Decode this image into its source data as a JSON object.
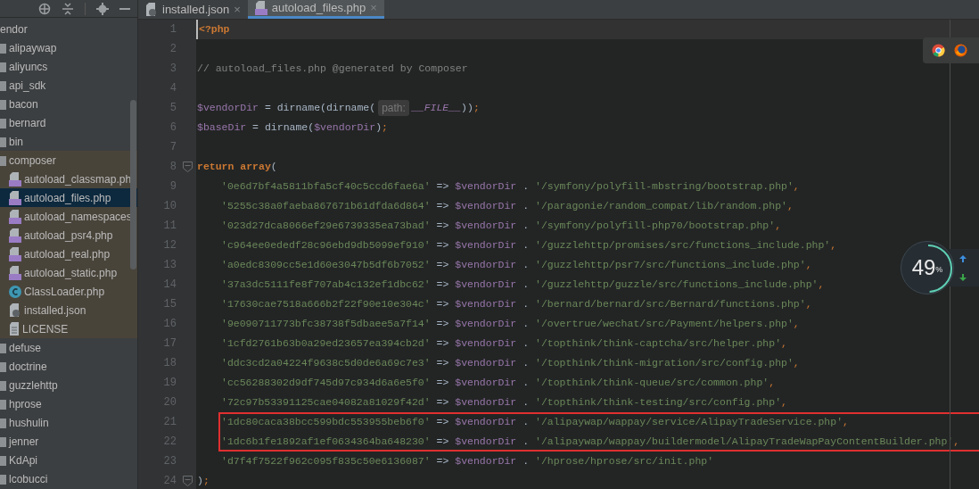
{
  "sidebar": {
    "tree": [
      {
        "label": "endor",
        "selected": false,
        "children": [
          {
            "label": "alipaywap",
            "kind": "folder",
            "expanded": false,
            "selected": false
          },
          {
            "label": "aliyuncs",
            "kind": "folder",
            "expanded": false,
            "selected": false
          },
          {
            "label": "api_sdk",
            "kind": "folder",
            "expanded": false,
            "selected": false
          },
          {
            "label": "bacon",
            "kind": "folder",
            "expanded": false,
            "selected": false
          },
          {
            "label": "bernard",
            "kind": "folder",
            "expanded": false,
            "selected": false
          },
          {
            "label": "bin",
            "kind": "folder",
            "expanded": false,
            "selected": false
          },
          {
            "label": "composer",
            "kind": "folder",
            "expanded": true,
            "selected": false,
            "children": [
              {
                "label": "autoload_classmap.ph",
                "kind": "php",
                "selected": false
              },
              {
                "label": "autoload_files.php",
                "kind": "php",
                "selected": true
              },
              {
                "label": "autoload_namespaces",
                "kind": "php",
                "selected": false
              },
              {
                "label": "autoload_psr4.php",
                "kind": "php",
                "selected": false
              },
              {
                "label": "autoload_real.php",
                "kind": "php",
                "selected": false
              },
              {
                "label": "autoload_static.php",
                "kind": "php",
                "selected": false
              },
              {
                "label": "ClassLoader.php",
                "kind": "class",
                "selected": false
              },
              {
                "label": "installed.json",
                "kind": "json",
                "selected": false
              },
              {
                "label": "LICENSE",
                "kind": "text",
                "selected": false
              }
            ]
          },
          {
            "label": "defuse",
            "kind": "folder",
            "expanded": false,
            "selected": false
          },
          {
            "label": "doctrine",
            "kind": "folder",
            "expanded": false,
            "selected": false
          },
          {
            "label": "guzzlehttp",
            "kind": "folder",
            "expanded": false,
            "selected": false
          },
          {
            "label": "hprose",
            "kind": "folder",
            "expanded": false,
            "selected": false
          },
          {
            "label": "hushulin",
            "kind": "folder",
            "expanded": false,
            "selected": false
          },
          {
            "label": "jenner",
            "kind": "folder",
            "expanded": false,
            "selected": false
          },
          {
            "label": "KdApi",
            "kind": "folder",
            "expanded": false,
            "selected": false
          },
          {
            "label": "lcobucci",
            "kind": "folder",
            "expanded": false,
            "selected": false
          }
        ]
      }
    ]
  },
  "tabs": [
    {
      "label": "installed.json",
      "kind": "json",
      "selected": false,
      "close": "×"
    },
    {
      "label": "autoload_files.php",
      "kind": "php",
      "selected": true,
      "close": "×"
    }
  ],
  "editor": {
    "lines": [
      {
        "number": "1",
        "current": true,
        "highlighted": false,
        "indent": false,
        "fold": false,
        "tokens": [
          {
            "kind": "keyword",
            "text": "<?php"
          }
        ]
      },
      {
        "number": "2",
        "current": false,
        "highlighted": false,
        "fold": false
      },
      {
        "number": "3",
        "current": false,
        "highlighted": false,
        "indent": false,
        "fold": false,
        "tokens": [
          {
            "kind": "comment",
            "text": "// autoload_files.php @generated by Composer"
          }
        ]
      },
      {
        "number": "4",
        "current": false,
        "highlighted": false,
        "fold": false
      },
      {
        "number": "5",
        "current": false,
        "highlighted": false,
        "indent": false,
        "fold": false,
        "tokens": [
          {
            "kind": "variable",
            "text": "$vendorDir"
          },
          {
            "kind": "plain",
            "text": " = dirname(dirname("
          },
          {
            "kind": "hint",
            "text": "path:"
          },
          {
            "kind": "constant",
            "text": "__FILE__"
          },
          {
            "kind": "plain",
            "text": "))"
          },
          {
            "kind": "punct",
            "text": ";"
          }
        ]
      },
      {
        "number": "6",
        "current": false,
        "highlighted": false,
        "indent": false,
        "fold": false,
        "tokens": [
          {
            "kind": "variable",
            "text": "$baseDir"
          },
          {
            "kind": "plain",
            "text": " = dirname("
          },
          {
            "kind": "variable",
            "text": "$vendorDir"
          },
          {
            "kind": "plain",
            "text": ")"
          },
          {
            "kind": "punct",
            "text": ";"
          }
        ]
      },
      {
        "number": "7",
        "current": false,
        "highlighted": false,
        "fold": false
      },
      {
        "number": "8",
        "current": false,
        "highlighted": false,
        "indent": false,
        "fold": true,
        "tokens": [
          {
            "kind": "keyword",
            "text": "return array"
          },
          {
            "kind": "plain",
            "text": "("
          }
        ]
      },
      {
        "number": "9",
        "current": false,
        "highlighted": false,
        "indent": true,
        "fold": false,
        "tokens": [
          {
            "kind": "string",
            "text": "'0e6d7bf4a5811bfa5cf40c5ccd6fae6a'"
          },
          {
            "kind": "plain",
            "text": " => "
          },
          {
            "kind": "variable",
            "text": "$vendorDir"
          },
          {
            "kind": "plain",
            "text": " . "
          },
          {
            "kind": "string",
            "text": "'/symfony/polyfill-mbstring/bootstrap.php'"
          },
          {
            "kind": "punct",
            "text": ","
          }
        ]
      },
      {
        "number": "10",
        "current": false,
        "highlighted": false,
        "indent": true,
        "fold": false,
        "tokens": [
          {
            "kind": "string",
            "text": "'5255c38a0faeba867671b61dfda6d864'"
          },
          {
            "kind": "plain",
            "text": " => "
          },
          {
            "kind": "variable",
            "text": "$vendorDir"
          },
          {
            "kind": "plain",
            "text": " . "
          },
          {
            "kind": "string",
            "text": "'/paragonie/random_compat/lib/random.php'"
          },
          {
            "kind": "punct",
            "text": ","
          }
        ]
      },
      {
        "number": "11",
        "current": false,
        "highlighted": false,
        "indent": true,
        "fold": false,
        "tokens": [
          {
            "kind": "string",
            "text": "'023d27dca8066ef29e6739335ea73bad'"
          },
          {
            "kind": "plain",
            "text": " => "
          },
          {
            "kind": "variable",
            "text": "$vendorDir"
          },
          {
            "kind": "plain",
            "text": " . "
          },
          {
            "kind": "string",
            "text": "'/symfony/polyfill-php70/bootstrap.php'"
          },
          {
            "kind": "punct",
            "text": ","
          }
        ]
      },
      {
        "number": "12",
        "current": false,
        "highlighted": false,
        "indent": true,
        "fold": false,
        "tokens": [
          {
            "kind": "string",
            "text": "'c964ee0ededf28c96ebd9db5099ef910'"
          },
          {
            "kind": "plain",
            "text": " => "
          },
          {
            "kind": "variable",
            "text": "$vendorDir"
          },
          {
            "kind": "plain",
            "text": " . "
          },
          {
            "kind": "string",
            "text": "'/guzzlehttp/promises/src/functions_include.php'"
          },
          {
            "kind": "punct",
            "text": ","
          }
        ]
      },
      {
        "number": "13",
        "current": false,
        "highlighted": false,
        "indent": true,
        "fold": false,
        "tokens": [
          {
            "kind": "string",
            "text": "'a0edc8309cc5e1d60e3047b5df6b7052'"
          },
          {
            "kind": "plain",
            "text": " => "
          },
          {
            "kind": "variable",
            "text": "$vendorDir"
          },
          {
            "kind": "plain",
            "text": " . "
          },
          {
            "kind": "string",
            "text": "'/guzzlehttp/psr7/src/functions_include.php'"
          },
          {
            "kind": "punct",
            "text": ","
          }
        ]
      },
      {
        "number": "14",
        "current": false,
        "highlighted": false,
        "indent": true,
        "fold": false,
        "tokens": [
          {
            "kind": "string",
            "text": "'37a3dc5111fe8f707ab4c132ef1dbc62'"
          },
          {
            "kind": "plain",
            "text": " => "
          },
          {
            "kind": "variable",
            "text": "$vendorDir"
          },
          {
            "kind": "plain",
            "text": " . "
          },
          {
            "kind": "string",
            "text": "'/guzzlehttp/guzzle/src/functions_include.php'"
          },
          {
            "kind": "punct",
            "text": ","
          }
        ]
      },
      {
        "number": "15",
        "current": false,
        "highlighted": false,
        "indent": true,
        "fold": false,
        "tokens": [
          {
            "kind": "string",
            "text": "'17630cae7518a666b2f22f90e10e304c'"
          },
          {
            "kind": "plain",
            "text": " => "
          },
          {
            "kind": "variable",
            "text": "$vendorDir"
          },
          {
            "kind": "plain",
            "text": " . "
          },
          {
            "kind": "string",
            "text": "'/bernard/bernard/src/Bernard/functions.php'"
          },
          {
            "kind": "punct",
            "text": ","
          }
        ]
      },
      {
        "number": "16",
        "current": false,
        "highlighted": false,
        "indent": true,
        "fold": false,
        "tokens": [
          {
            "kind": "string",
            "text": "'9e090711773bfc38738f5dbaee5a7f14'"
          },
          {
            "kind": "plain",
            "text": " => "
          },
          {
            "kind": "variable",
            "text": "$vendorDir"
          },
          {
            "kind": "plain",
            "text": " . "
          },
          {
            "kind": "string",
            "text": "'/overtrue/wechat/src/Payment/helpers.php'"
          },
          {
            "kind": "punct",
            "text": ","
          }
        ]
      },
      {
        "number": "17",
        "current": false,
        "highlighted": false,
        "indent": true,
        "fold": false,
        "tokens": [
          {
            "kind": "string",
            "text": "'1cfd2761b63b0a29ed23657ea394cb2d'"
          },
          {
            "kind": "plain",
            "text": " => "
          },
          {
            "kind": "variable",
            "text": "$vendorDir"
          },
          {
            "kind": "plain",
            "text": " . "
          },
          {
            "kind": "string",
            "text": "'/topthink/think-captcha/src/helper.php'"
          },
          {
            "kind": "punct",
            "text": ","
          }
        ]
      },
      {
        "number": "18",
        "current": false,
        "highlighted": false,
        "indent": true,
        "fold": false,
        "tokens": [
          {
            "kind": "string",
            "text": "'ddc3cd2a04224f9638c5d0de6a69c7e3'"
          },
          {
            "kind": "plain",
            "text": " => "
          },
          {
            "kind": "variable",
            "text": "$vendorDir"
          },
          {
            "kind": "plain",
            "text": " . "
          },
          {
            "kind": "string",
            "text": "'/topthink/think-migration/src/config.php'"
          },
          {
            "kind": "punct",
            "text": ","
          }
        ]
      },
      {
        "number": "19",
        "current": false,
        "highlighted": false,
        "indent": true,
        "fold": false,
        "tokens": [
          {
            "kind": "string",
            "text": "'cc56288302d9df745d97c934d6a6e5f0'"
          },
          {
            "kind": "plain",
            "text": " => "
          },
          {
            "kind": "variable",
            "text": "$vendorDir"
          },
          {
            "kind": "plain",
            "text": " . "
          },
          {
            "kind": "string",
            "text": "'/topthink/think-queue/src/common.php'"
          },
          {
            "kind": "punct",
            "text": ","
          }
        ]
      },
      {
        "number": "20",
        "current": false,
        "highlighted": false,
        "indent": true,
        "fold": false,
        "tokens": [
          {
            "kind": "string",
            "text": "'72c97b53391125cae04082a81029f42d'"
          },
          {
            "kind": "plain",
            "text": " => "
          },
          {
            "kind": "variable",
            "text": "$vendorDir"
          },
          {
            "kind": "plain",
            "text": " . "
          },
          {
            "kind": "string",
            "text": "'/topthink/think-testing/src/config.php'"
          },
          {
            "kind": "punct",
            "text": ","
          }
        ]
      },
      {
        "number": "21",
        "current": false,
        "highlighted": true,
        "indent": true,
        "fold": false,
        "tokens": [
          {
            "kind": "string",
            "text": "'1dc80caca38bcc599bdc553955beb6f0'"
          },
          {
            "kind": "plain",
            "text": " => "
          },
          {
            "kind": "variable",
            "text": "$vendorDir"
          },
          {
            "kind": "plain",
            "text": " . "
          },
          {
            "kind": "string",
            "text": "'/alipaywap/wappay/service/AlipayTradeService.php'"
          },
          {
            "kind": "punct",
            "text": ","
          }
        ]
      },
      {
        "number": "22",
        "current": false,
        "highlighted": true,
        "indent": true,
        "fold": false,
        "tokens": [
          {
            "kind": "string",
            "text": "'1dc6b1fe1892af1ef0634364ba648230'"
          },
          {
            "kind": "plain",
            "text": " => "
          },
          {
            "kind": "variable",
            "text": "$vendorDir"
          },
          {
            "kind": "plain",
            "text": " . "
          },
          {
            "kind": "string",
            "text": "'/alipaywap/wappay/buildermodel/AlipayTradeWapPayContentBuilder.php'"
          },
          {
            "kind": "punct",
            "text": ","
          }
        ]
      },
      {
        "number": "23",
        "current": false,
        "highlighted": false,
        "indent": true,
        "fold": false,
        "tokens": [
          {
            "kind": "string",
            "text": "'d7f4f7522f962c095f835c50e6136087'"
          },
          {
            "kind": "plain",
            "text": " => "
          },
          {
            "kind": "variable",
            "text": "$vendorDir"
          },
          {
            "kind": "plain",
            "text": " . "
          },
          {
            "kind": "string",
            "text": "'/hprose/hprose/src/init.php'"
          }
        ]
      },
      {
        "number": "24",
        "current": false,
        "highlighted": false,
        "indent": false,
        "fold": true,
        "tokens": [
          {
            "kind": "plain",
            "text": ")"
          },
          {
            "kind": "punct",
            "text": ";"
          }
        ]
      }
    ]
  },
  "memory_widget": {
    "value": "49",
    "unit": "%",
    "level": 0.49
  }
}
